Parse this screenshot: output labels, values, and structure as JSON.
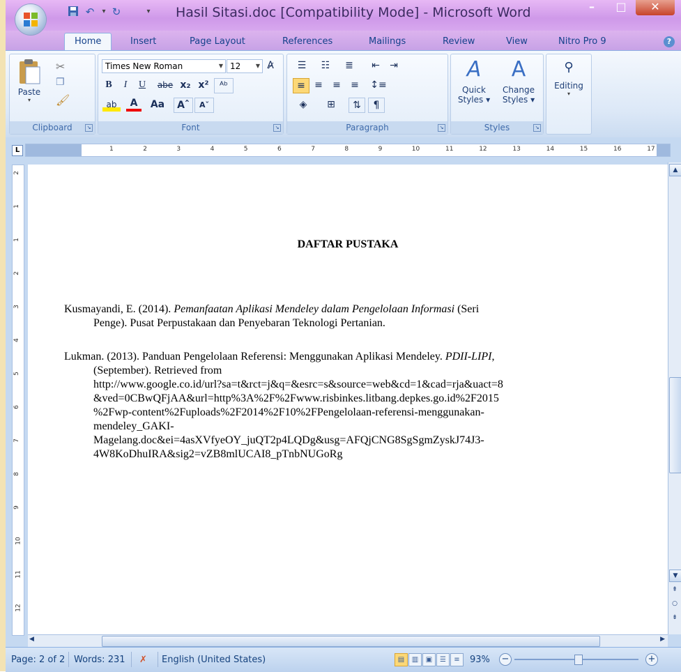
{
  "window": {
    "title": "Hasil Sitasi.doc [Compatibility Mode] - Microsoft Word",
    "min_glyph": "–",
    "max_glyph": "□",
    "close_glyph": "✕"
  },
  "tabs": [
    "Home",
    "Insert",
    "Page Layout",
    "References",
    "Mailings",
    "Review",
    "View",
    "Nitro Pro 9"
  ],
  "active_tab": "Home",
  "ribbon": {
    "clipboard": {
      "label": "Clipboard",
      "paste": "Paste"
    },
    "font": {
      "label": "Font",
      "font_name": "Times New Roman",
      "font_size": "12",
      "bold": "B",
      "italic": "I",
      "underline": "U",
      "strike": "abe",
      "sub": "x₂",
      "sup": "x²",
      "grow": "A",
      "shrink": "A",
      "case": "Aa"
    },
    "paragraph": {
      "label": "Paragraph",
      "pilcrow": "¶"
    },
    "styles": {
      "label": "Styles",
      "quick": "Quick",
      "quick2": "Styles",
      "change": "Change",
      "change2": "Styles"
    },
    "editing": {
      "label": "Editing"
    }
  },
  "document": {
    "heading": "DAFTAR PUSTAKA",
    "ref1": {
      "part1": "Kusmayandi, E. (2014). ",
      "italic": "Pemanfaatan Aplikasi Mendeley dalam Pengelolaan Informasi",
      "part2": " (Seri",
      "line2": "Penge). Pusat Perpustakaan dan Penyebaran Teknologi Pertanian."
    },
    "ref2": {
      "part1": "Lukman. (2013). Panduan Pengelolaan Referensi: Menggunakan Aplikasi Mendeley. ",
      "italic": "PDII-LIPI",
      "part2": ",",
      "lines": [
        "(September). Retrieved from",
        "http://www.google.co.id/url?sa=t&rct=j&q=&esrc=s&source=web&cd=1&cad=rja&uact=8",
        "&ved=0CBwQFjAA&url=http%3A%2F%2Fwww.risbinkes.litbang.depkes.go.id%2F2015",
        "%2Fwp-content%2Fuploads%2F2014%2F10%2FPengelolaan-referensi-menggunakan-",
        "mendeley_GAKI-",
        "Magelang.doc&ei=4asXVfyeOY_juQT2p4LQDg&usg=AFQjCNG8SgSgmZyskJ74J3-",
        "4W8KoDhuIRA&sig2=vZB8mlUCAI8_pTnbNUGoRg"
      ]
    }
  },
  "status": {
    "page": "Page: 2 of 2",
    "words": "Words: 231",
    "language": "English (United States)",
    "zoom": "93%"
  },
  "ruler_numbers": [
    "1",
    "2",
    "3",
    "4",
    "5",
    "6",
    "7",
    "8",
    "9",
    "10",
    "11",
    "12",
    "13",
    "14",
    "15",
    "16",
    "17"
  ],
  "vruler_numbers": [
    "2",
    "1",
    "1",
    "2",
    "3",
    "4",
    "5",
    "6",
    "7",
    "8",
    "9",
    "10",
    "11",
    "12"
  ]
}
